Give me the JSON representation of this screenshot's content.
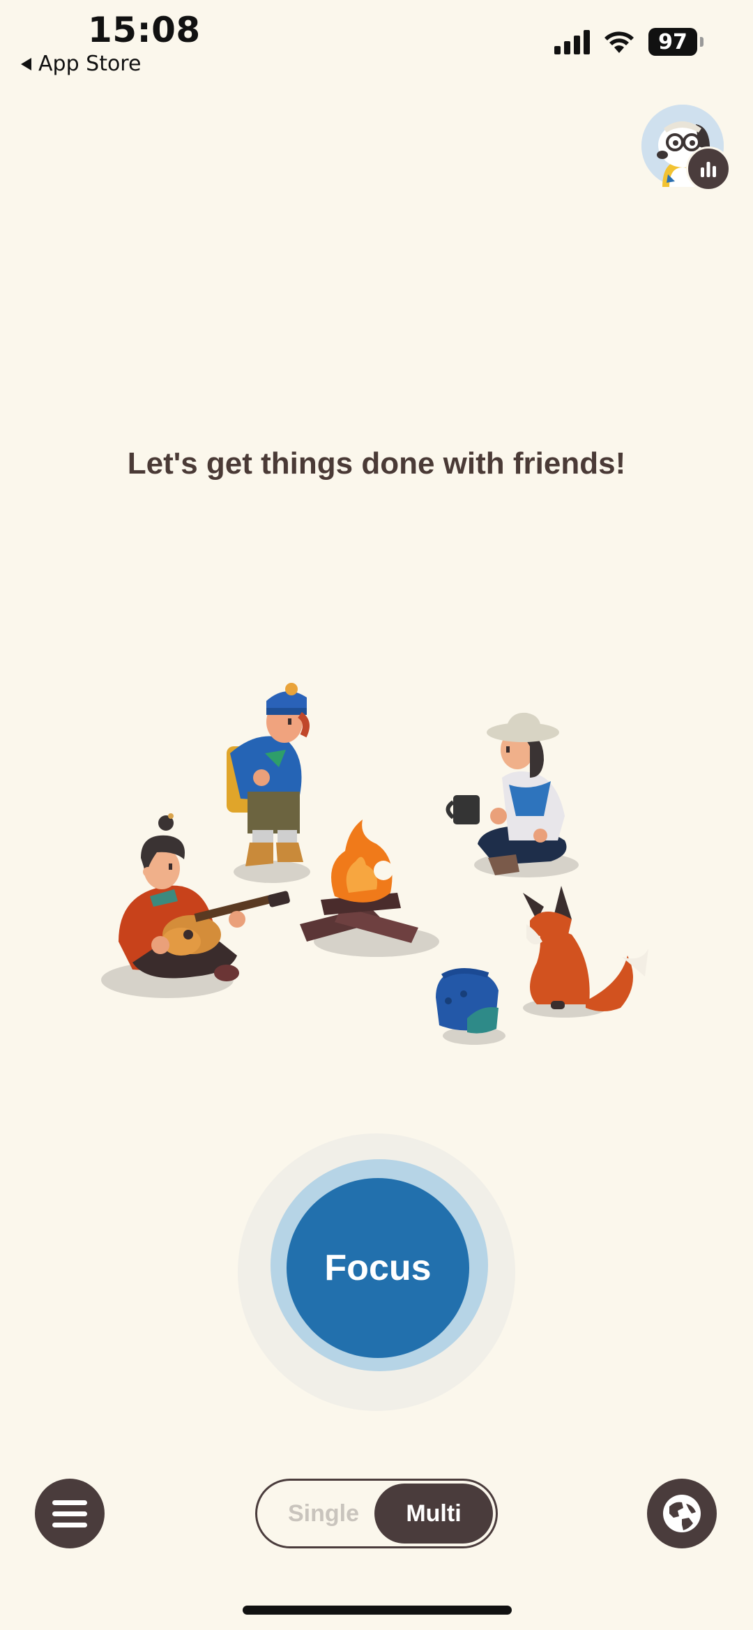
{
  "status_bar": {
    "time": "15:08",
    "back_label": "App Store",
    "battery": "97"
  },
  "headline": "Let's get things done with friends!",
  "focus_button": {
    "label": "Focus"
  },
  "mode_toggle": {
    "single_label": "Single",
    "multi_label": "Multi",
    "selected": "Multi"
  },
  "icons": {
    "menu": "hamburger-menu-icon",
    "globe": "globe-icon",
    "stats": "bar-chart-icon",
    "avatar": "dog-avatar-icon"
  },
  "colors": {
    "background": "#fbf7ec",
    "focus_blue": "#2270ad",
    "dark_brown": "#4a3c3c",
    "headline": "#4a3a36"
  }
}
